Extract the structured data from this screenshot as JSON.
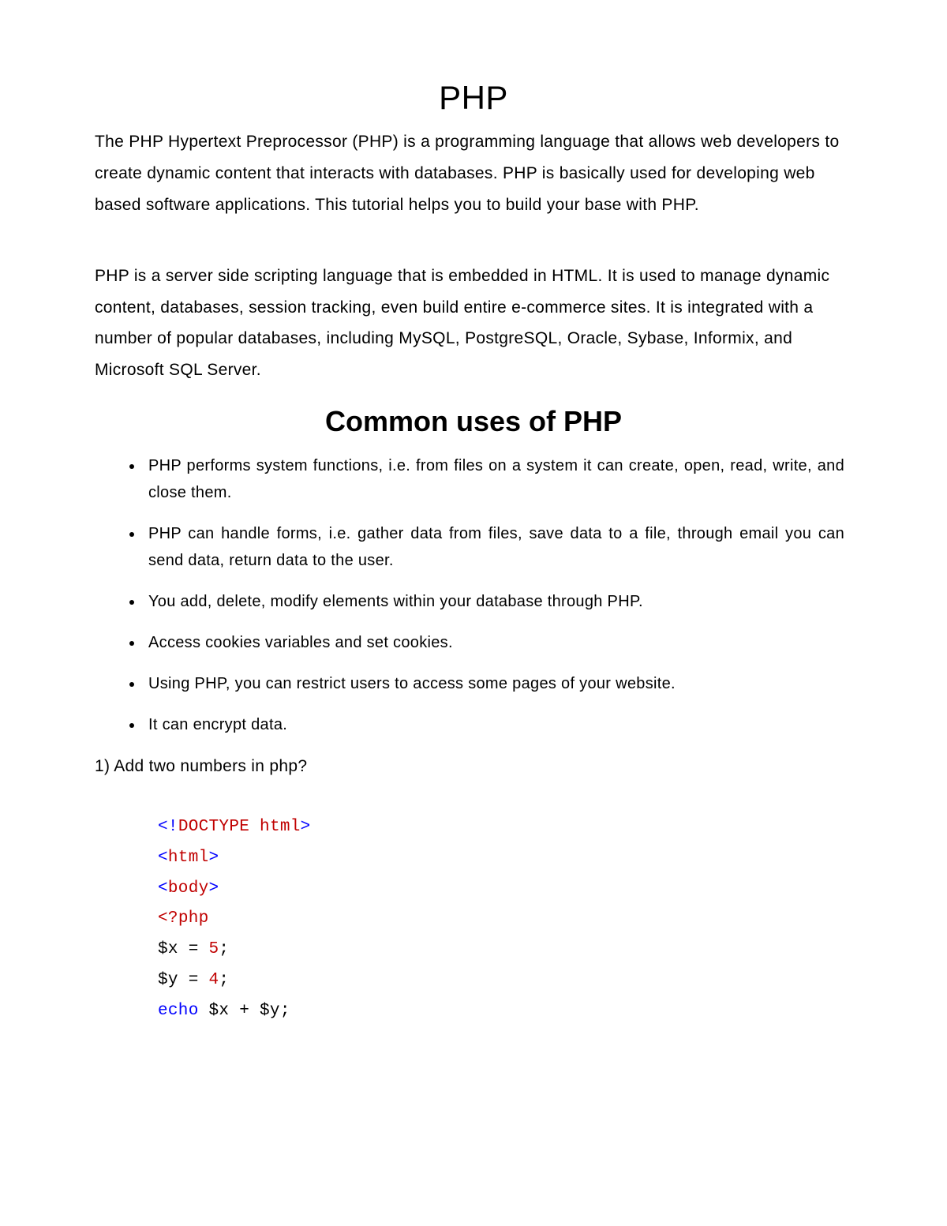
{
  "title": "PHP",
  "intro": "The PHP Hypertext Preprocessor (PHP) is a programming language that allows web developers to create dynamic content that interacts with databases. PHP is basically used for developing web based software applications. This tutorial helps you to build your base with PHP.",
  "para2": "PHP is a server side scripting language that is embedded in HTML. It is used to manage dynamic content, databases, session tracking, even build entire e-commerce sites. It is integrated with a number of popular databases, including MySQL, PostgreSQL, Oracle, Sybase, Informix, and Microsoft SQL Server.",
  "heading2": "Common uses of PHP",
  "uses": [
    "PHP performs system functions, i.e. from files on a system it can create, open, read, write, and close them.",
    "PHP can handle forms, i.e. gather data from files, save data to a file, through email you can send data, return data to the user.",
    "You add, delete, modify elements within your database through PHP.",
    "Access cookies variables and set cookies.",
    "Using PHP, you can restrict users to access some pages of your website.",
    "It can encrypt data."
  ],
  "question": "1) Add two numbers in php?",
  "code": {
    "line1": {
      "a": "<!",
      "b": "DOCTYPE",
      "c": " html",
      "d": ">"
    },
    "line2": {
      "a": "<",
      "b": "html",
      "c": ">"
    },
    "line3": {
      "a": "<",
      "b": "body",
      "c": ">"
    },
    "line4": {
      "a": "<?",
      "b": "php"
    },
    "line5": {
      "a": "$x = ",
      "b": "5",
      "c": ";"
    },
    "line6": {
      "a": "$y = ",
      "b": "4",
      "c": ";"
    },
    "line7": {
      "a": "echo",
      "b": " $x + $y;"
    }
  }
}
